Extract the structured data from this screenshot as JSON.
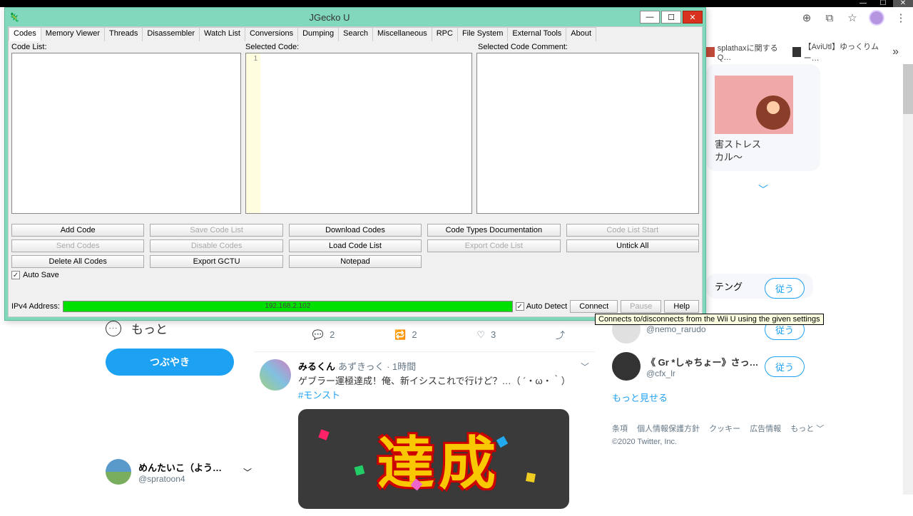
{
  "sysbar": {
    "min": "—",
    "max": "☐",
    "close": "✕"
  },
  "browser": {
    "bookmarks": [
      {
        "label": "splathaxに関するQ…"
      },
      {
        "label": "【AviUtl】ゆっくりムー…"
      }
    ],
    "more": "»"
  },
  "right": {
    "trend_lines": [
      "害ストレス",
      "カル～"
    ],
    "chevron": "﹀"
  },
  "who_follow": {
    "items": [
      {
        "name": "",
        "handle": "@nemo_rarudo",
        "btn": "従う"
      },
      {
        "name": "《 Gr *しゃちょー》さっち…",
        "handle": "@cfx_lr",
        "btn": "従う"
      }
    ],
    "show_more": "もっと見せる"
  },
  "footer": {
    "links": [
      "条項",
      "個人情報保護方針",
      "クッキー",
      "広告情報",
      "もっと ﹀"
    ],
    "copyright": "©2020 Twitter, Inc."
  },
  "left": {
    "more_label": "もっと",
    "tweet_btn": "つぶやき",
    "user_name": "めんたいこ（よう…",
    "user_handle": "@spratoon4"
  },
  "feed": {
    "actions": {
      "reply": "2",
      "retweet": "2",
      "like": "3"
    },
    "tweet": {
      "name": "みるくん",
      "meta": "あずきっく · 1時間",
      "body": "ゲブラー運極達成！俺、新イシスこれで行けど？…（ ´・ω・｀）",
      "hashtag": "#モンスト",
      "image_text": "達 成"
    }
  },
  "jgecko": {
    "title": "JGecko U",
    "tabs": [
      "Codes",
      "Memory Viewer",
      "Threads",
      "Disassembler",
      "Watch List",
      "Conversions",
      "Dumping",
      "Search",
      "Miscellaneous",
      "RPC",
      "File System",
      "External Tools",
      "About"
    ],
    "labels": {
      "codelist": "Code List:",
      "selcode": "Selected Code:",
      "comment": "Selected Code Comment:"
    },
    "line1": "1",
    "buttons_row1": [
      "Add Code",
      "Save Code List",
      "Download Codes",
      "Code Types Documentation",
      "Code List Start"
    ],
    "buttons_row2": [
      "Send Codes",
      "Disable Codes",
      "Load Code List",
      "Export Code List",
      "Untick All"
    ],
    "buttons_row3": [
      "Delete All Codes",
      "Export GCTU",
      "Notepad",
      "",
      ""
    ],
    "disabled": [
      "Save Code List",
      "Send Codes",
      "Disable Codes",
      "Export Code List",
      "Code List Start"
    ],
    "autosave": "Auto Save",
    "ip_label": "IPv4 Address:",
    "ip_value": "192.168.2.102",
    "auto_detect": "Auto Detect",
    "connect": "Connect",
    "pause": "Pause",
    "help": "Help",
    "tooltip": "Connects to/disconnects from the Wii U using the given settings"
  }
}
